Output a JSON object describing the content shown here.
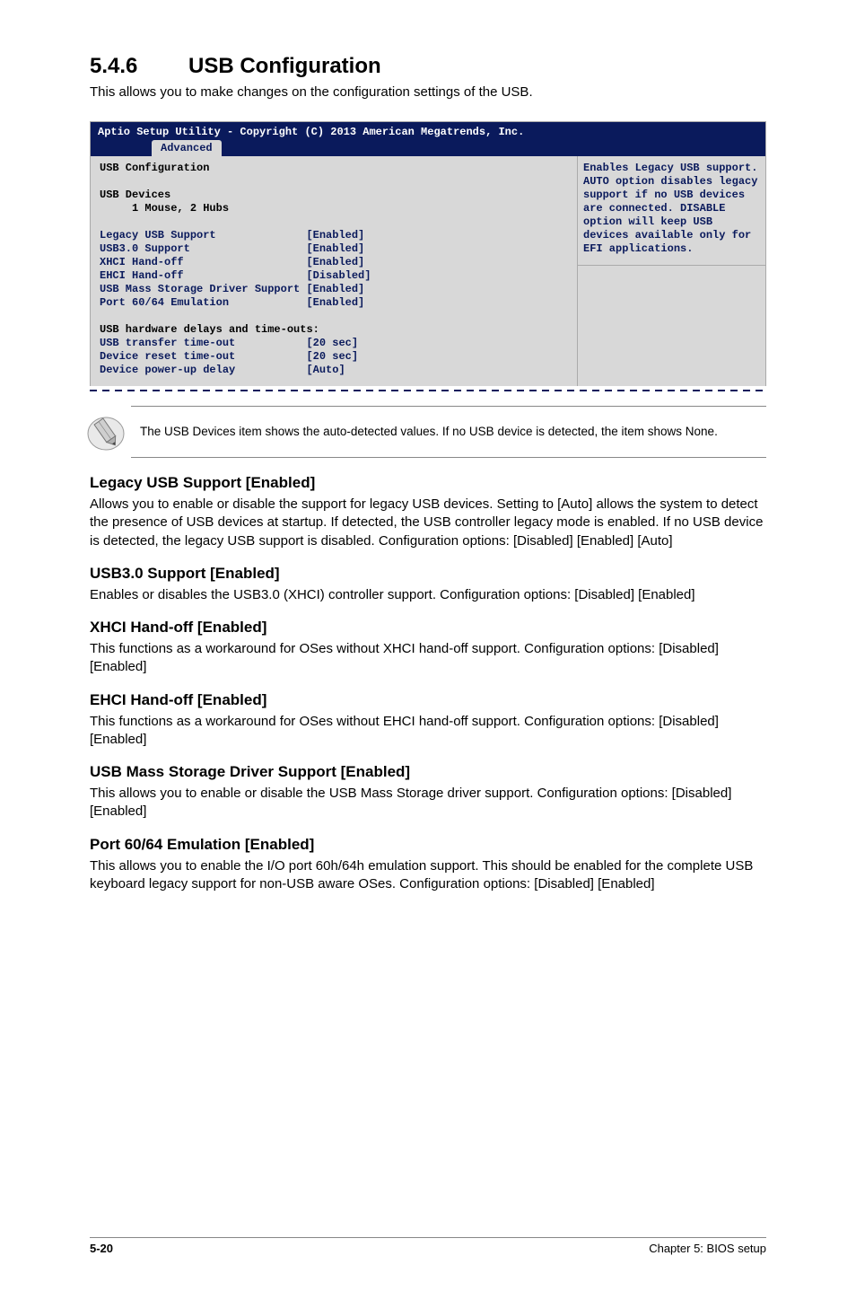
{
  "section": {
    "number": "5.4.6",
    "title": "USB Configuration",
    "intro": "This allows you to make changes on the configuration settings of the USB."
  },
  "bios": {
    "header": "Aptio Setup Utility - Copyright (C) 2013 American Megatrends, Inc.",
    "tab": "Advanced",
    "left_black_lines": {
      "cfg_title": "USB Configuration",
      "devices_label": "USB Devices",
      "devices_value": "     1 Mouse, 2 Hubs",
      "timeouts_title": "USB hardware delays and time-outs:"
    },
    "items": [
      {
        "label": "Legacy USB Support",
        "value": "[Enabled]"
      },
      {
        "label": "USB3.0 Support",
        "value": "[Enabled]"
      },
      {
        "label": "XHCI Hand-off",
        "value": "[Enabled]"
      },
      {
        "label": "EHCI Hand-off",
        "value": "[Disabled]"
      },
      {
        "label": "USB Mass Storage Driver Support",
        "value": "[Enabled]"
      },
      {
        "label": "Port 60/64 Emulation",
        "value": "[Enabled]"
      }
    ],
    "timeouts": [
      {
        "label": "USB transfer time-out",
        "value": "[20 sec]"
      },
      {
        "label": "Device reset time-out",
        "value": "[20 sec]"
      },
      {
        "label": "Device power-up delay",
        "value": "[Auto]"
      }
    ],
    "help": "Enables Legacy USB support. AUTO option disables legacy support if no USB devices are connected. DISABLE option will keep USB devices available only for EFI applications."
  },
  "note": "The USB Devices item shows the auto-detected values. If no USB device is detected, the item shows None.",
  "subsections": [
    {
      "heading": "Legacy USB Support [Enabled]",
      "body": "Allows you to enable or disable the support for legacy USB devices. Setting to [Auto] allows the system to detect the presence of USB devices at startup. If detected, the USB controller legacy mode is enabled. If no USB device is detected, the legacy USB support is disabled. Configuration options: [Disabled] [Enabled] [Auto]"
    },
    {
      "heading": "USB3.0 Support [Enabled]",
      "body": "Enables or disables the USB3.0 (XHCI) controller support. Configuration options: [Disabled] [Enabled]"
    },
    {
      "heading": "XHCI Hand-off [Enabled]",
      "body": "This functions as a workaround for OSes without XHCI hand-off support. Configuration options: [Disabled] [Enabled]"
    },
    {
      "heading": "EHCI Hand-off [Enabled]",
      "body": "This functions as a workaround for OSes without EHCI hand-off support. Configuration options: [Disabled] [Enabled]"
    },
    {
      "heading": "USB Mass Storage Driver Support [Enabled]",
      "body": "This allows you to enable or disable the USB Mass Storage driver support. Configuration options: [Disabled] [Enabled]"
    },
    {
      "heading": "Port 60/64 Emulation [Enabled]",
      "body": "This allows you to enable the I/O port 60h/64h emulation support. This should be enabled for the complete USB keyboard legacy support for non-USB aware OSes. Configuration options: [Disabled] [Enabled]"
    }
  ],
  "footer": {
    "pagenum": "5-20",
    "chapter": "Chapter 5: BIOS setup"
  }
}
